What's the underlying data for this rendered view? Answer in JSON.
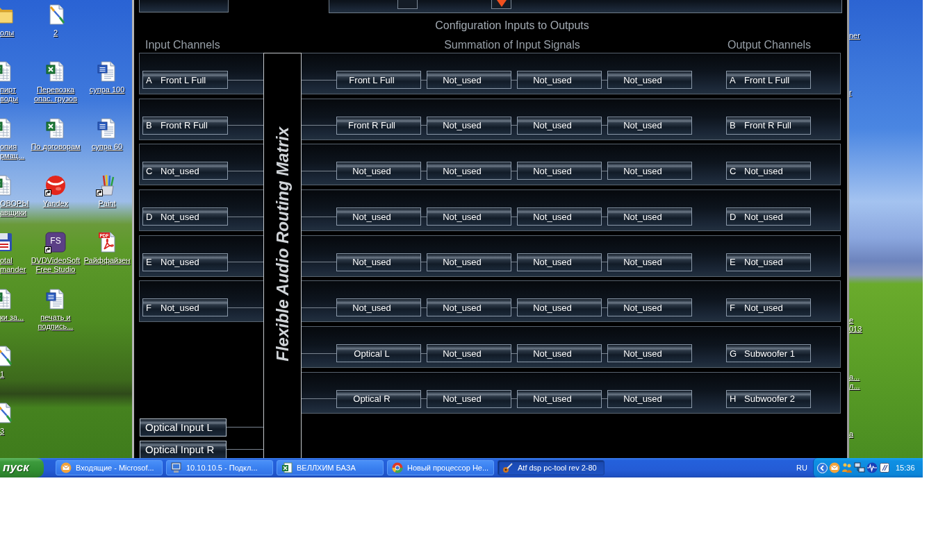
{
  "desktop_left": {
    "rows": [
      [
        {
          "lines": [
            "олы"
          ],
          "kind": "folder",
          "shortcut": false
        },
        {
          "lines": [
            "2"
          ],
          "kind": "paint-doc",
          "shortcut": false
        },
        null
      ],
      [
        {
          "lines": [
            "пирт",
            "воды"
          ],
          "kind": "excel",
          "shortcut": false
        },
        {
          "lines": [
            "Перевозка",
            "опас. грузов"
          ],
          "kind": "excel",
          "shortcut": false
        },
        {
          "lines": [
            "супра 100"
          ],
          "kind": "word",
          "shortcut": false
        }
      ],
      [
        {
          "lines": [
            "опия",
            "рмац..."
          ],
          "kind": "excel",
          "shortcut": false
        },
        {
          "lines": [
            "По договорам"
          ],
          "kind": "excel",
          "shortcut": false
        },
        {
          "lines": [
            "супра 60"
          ],
          "kind": "word",
          "shortcut": false
        }
      ],
      [
        {
          "lines": [
            "ОВОРЫ",
            "авщики"
          ],
          "kind": "excel",
          "shortcut": false
        },
        {
          "lines": [
            "Yandex"
          ],
          "kind": "ball",
          "shortcut": true
        },
        {
          "lines": [
            "Paint"
          ],
          "kind": "paint",
          "shortcut": true
        }
      ],
      [
        {
          "lines": [
            "otal",
            "mander"
          ],
          "kind": "floppy",
          "shortcut": false
        },
        {
          "lines": [
            "DVDVideoSoft",
            "Free Studio"
          ],
          "kind": "tile",
          "badge": "FS",
          "shortcut": true
        },
        {
          "lines": [
            "Райффайзен"
          ],
          "kind": "pdf",
          "badge": "PDF",
          "shortcut": false
        }
      ],
      [
        {
          "lines": [
            "ки за..."
          ],
          "kind": "excel",
          "shortcut": false
        },
        {
          "lines": [
            "печать и",
            "подпись..."
          ],
          "kind": "word",
          "shortcut": false
        },
        null
      ],
      [
        {
          "lines": [
            "1"
          ],
          "kind": "paint-doc",
          "shortcut": false
        },
        null,
        null
      ],
      [
        {
          "lines": [
            "3"
          ],
          "kind": "paint-doc",
          "shortcut": false
        },
        null,
        null
      ]
    ]
  },
  "window": {
    "top_bar": {
      "checkboxes": [
        {
          "checked": false
        },
        {
          "checked": true
        }
      ]
    },
    "title": "Configuration Inputs to Outputs",
    "headings": {
      "inputs": "Input Channels",
      "summation": "Summation of Input Signals",
      "outputs": "Output Channels"
    },
    "matrix_label": "Flexible Audio Routing Matrix",
    "rows": [
      {
        "input": {
          "letter": "A",
          "name": "Front L Full"
        },
        "sums": [
          "Front L Full",
          "Not_used",
          "Not_used",
          "Not_used"
        ],
        "output": {
          "letter": "A",
          "name": "Front L Full"
        }
      },
      {
        "input": {
          "letter": "B",
          "name": "Front R Full"
        },
        "sums": [
          "Front R Full",
          "Not_used",
          "Not_used",
          "Not_used"
        ],
        "output": {
          "letter": "B",
          "name": "Front R Full"
        }
      },
      {
        "input": {
          "letter": "C",
          "name": "Not_used"
        },
        "sums": [
          "Not_used",
          "Not_used",
          "Not_used",
          "Not_used"
        ],
        "output": {
          "letter": "C",
          "name": "Not_used"
        }
      },
      {
        "input": {
          "letter": "D",
          "name": "Not_used"
        },
        "sums": [
          "Not_used",
          "Not_used",
          "Not_used",
          "Not_used"
        ],
        "output": {
          "letter": "D",
          "name": "Not_used"
        }
      },
      {
        "input": {
          "letter": "E",
          "name": "Not_used"
        },
        "sums": [
          "Not_used",
          "Not_used",
          "Not_used",
          "Not_used"
        ],
        "output": {
          "letter": "E",
          "name": "Not_used"
        }
      },
      {
        "input": {
          "letter": "F",
          "name": "Not_used"
        },
        "sums": [
          "Not_used",
          "Not_used",
          "Not_used",
          "Not_used"
        ],
        "output": {
          "letter": "F",
          "name": "Not_used"
        }
      },
      {
        "sums": [
          "Optical L",
          "Not_used",
          "Not_used",
          "Not_used"
        ],
        "output": {
          "letter": "G",
          "name": "Subwoofer 1"
        }
      },
      {
        "sums": [
          "Optical R",
          "Not_used",
          "Not_used",
          "Not_used"
        ],
        "output": {
          "letter": "H",
          "name": "Subwoofer 2"
        }
      }
    ],
    "optical_inputs": [
      "Optical Input L",
      "Optical Input R"
    ]
  },
  "desktop_right": {
    "rows": [
      {
        "lines": [
          "ner"
        ]
      },
      {
        "lines": [
          "r"
        ]
      },
      null,
      null,
      null,
      {
        "lines": [
          "е",
          "013"
        ]
      },
      {
        "lines": [
          "а...",
          "л..."
        ]
      },
      {
        "lines": [
          "a"
        ]
      }
    ]
  },
  "taskbar": {
    "start": "пуск",
    "tasks": [
      {
        "label": "Входящие - Microsof...",
        "kind": "mail",
        "selected": false
      },
      {
        "label": "10.10.10.5 - Подкл...",
        "kind": "remote",
        "selected": false
      },
      {
        "label": "ВЕЛЛХИМ БАЗА",
        "kind": "spreadsheet",
        "selected": false
      },
      {
        "label": "Новый процессор Не...",
        "kind": "browser",
        "selected": false
      },
      {
        "label": "Atf dsp pc-tool rev 2-80",
        "kind": "audio",
        "selected": true
      }
    ],
    "language": "RU",
    "clock": "15:36"
  }
}
